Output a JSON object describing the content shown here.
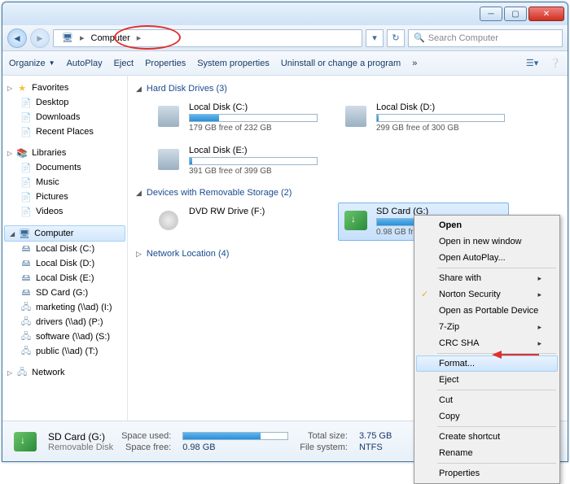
{
  "address": {
    "location": "Computer"
  },
  "search": {
    "placeholder": "Search Computer"
  },
  "toolbar": {
    "organize": "Organize",
    "autoplay": "AutoPlay",
    "eject": "Eject",
    "properties": "Properties",
    "sysprops": "System properties",
    "uninstall": "Uninstall or change a program",
    "more": "»"
  },
  "nav": {
    "fav": {
      "label": "Favorites",
      "items": [
        "Desktop",
        "Downloads",
        "Recent Places"
      ]
    },
    "lib": {
      "label": "Libraries",
      "items": [
        "Documents",
        "Music",
        "Pictures",
        "Videos"
      ]
    },
    "comp": {
      "label": "Computer",
      "items": [
        "Local Disk (C:)",
        "Local Disk (D:)",
        "Local Disk (E:)",
        "SD Card (G:)",
        "marketing (\\\\ad) (I:)",
        "drivers (\\\\ad) (P:)",
        "software (\\\\ad) (S:)",
        "public (\\\\ad) (T:)"
      ]
    },
    "net": {
      "label": "Network"
    }
  },
  "content": {
    "hdd": {
      "label": "Hard Disk Drives (3)",
      "drives": [
        {
          "name": "Local Disk (C:)",
          "free": "179 GB free of 232 GB",
          "pct": 23
        },
        {
          "name": "Local Disk (D:)",
          "free": "299 GB free of 300 GB",
          "pct": 1
        },
        {
          "name": "Local Disk (E:)",
          "free": "391 GB free of 399 GB",
          "pct": 2
        }
      ]
    },
    "rem": {
      "label": "Devices with Removable Storage (2)",
      "drives": [
        {
          "name": "DVD RW Drive (F:)",
          "free": "",
          "pct": -1,
          "type": "dvd"
        },
        {
          "name": "SD Card (G:)",
          "free": "0.98 GB free of 3.75 GB",
          "pct": 74,
          "type": "sd",
          "selected": true
        }
      ]
    },
    "net": {
      "label": "Network Location (4)"
    }
  },
  "context": {
    "items": [
      {
        "label": "Open",
        "bold": true
      },
      {
        "label": "Open in new window"
      },
      {
        "label": "Open AutoPlay..."
      },
      {
        "sep": true
      },
      {
        "label": "Share with",
        "sub": true
      },
      {
        "label": "Norton Security",
        "sub": true,
        "icon": "shield"
      },
      {
        "label": "Open as Portable Device"
      },
      {
        "label": "7-Zip",
        "sub": true
      },
      {
        "label": "CRC SHA",
        "sub": true
      },
      {
        "sep": true
      },
      {
        "label": "Format...",
        "hl": true
      },
      {
        "label": "Eject"
      },
      {
        "sep": true
      },
      {
        "label": "Cut"
      },
      {
        "label": "Copy"
      },
      {
        "sep": true
      },
      {
        "label": "Create shortcut"
      },
      {
        "label": "Rename"
      },
      {
        "sep": true
      },
      {
        "label": "Properties"
      }
    ]
  },
  "status": {
    "title": "SD Card (G:)",
    "subtitle": "Removable Disk",
    "spaceused_lbl": "Space used:",
    "spacefree_lbl": "Space free:",
    "spacefree": "0.98 GB",
    "total_lbl": "Total size:",
    "total": "3.75 GB",
    "fs_lbl": "File system:",
    "fs": "NTFS",
    "used_pct": 74
  }
}
